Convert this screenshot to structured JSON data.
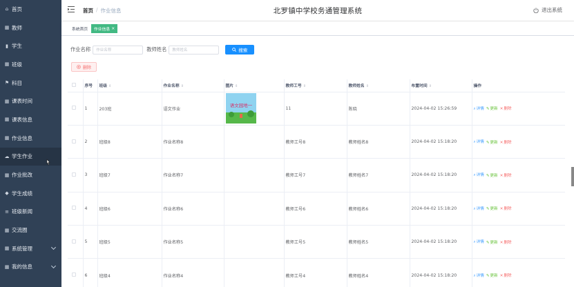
{
  "app": {
    "title": "北罗镇中学校务通管理系统",
    "logout_label": "退出系统",
    "accent": "#42b983",
    "primary": "#1890ff",
    "danger": "#f56c6c"
  },
  "sidebar": {
    "items": [
      {
        "label": "首页",
        "icon": "home-icon"
      },
      {
        "label": "教师",
        "icon": "grid-icon"
      },
      {
        "label": "学生",
        "icon": "bar-chart-icon"
      },
      {
        "label": "班级",
        "icon": "grid-icon"
      },
      {
        "label": "科目",
        "icon": "flag-icon"
      },
      {
        "label": "课表时间",
        "icon": "grid-icon"
      },
      {
        "label": "课表信息",
        "icon": "grid-icon"
      },
      {
        "label": "作业信息",
        "icon": "grid-icon"
      },
      {
        "label": "学生作业",
        "icon": "cloud-icon"
      },
      {
        "label": "作业批改",
        "icon": "grid-icon"
      },
      {
        "label": "学生成绩",
        "icon": "pin-icon"
      },
      {
        "label": "班级新闻",
        "icon": "list-icon"
      },
      {
        "label": "交流圈",
        "icon": "grid-icon"
      },
      {
        "label": "系统管理",
        "icon": "grid-icon"
      },
      {
        "label": "我的信息",
        "icon": "grid-icon"
      }
    ]
  },
  "breadcrumb": {
    "home": "首页",
    "separator": "/",
    "current": "作业信息"
  },
  "tags": {
    "home": "系统首页",
    "active": "作业信息",
    "close": "×"
  },
  "search": {
    "label1": "作业名称",
    "placeholder1": "作业名称",
    "label2": "教师姓名",
    "placeholder2": "教师姓名",
    "button": "搜索",
    "delete_button": "删除"
  },
  "table": {
    "headers": [
      "序号",
      "班级",
      "作业名称",
      "图片",
      "教师工号",
      "教师姓名",
      "布置时间",
      "操作"
    ],
    "rows": [
      {
        "no": "1",
        "class": "203班",
        "name": "语文作业",
        "has_image": true,
        "teacher_id": "11",
        "teacher_name": "陈晓",
        "time": "2024-04-02 15:26:59"
      },
      {
        "no": "2",
        "class": "班级8",
        "name": "作业名称8",
        "has_image": false,
        "teacher_id": "教师工号8",
        "teacher_name": "教师姓名8",
        "time": "2024-04-02 15:18:20"
      },
      {
        "no": "3",
        "class": "班级7",
        "name": "作业名称7",
        "has_image": false,
        "teacher_id": "教师工号7",
        "teacher_name": "教师姓名7",
        "time": "2024-04-02 15:18:20"
      },
      {
        "no": "4",
        "class": "班级6",
        "name": "作业名称6",
        "has_image": false,
        "teacher_id": "教师工号6",
        "teacher_name": "教师姓名6",
        "time": "2024-04-02 15:18:20"
      },
      {
        "no": "5",
        "class": "班级5",
        "name": "作业名称5",
        "has_image": false,
        "teacher_id": "教师工号5",
        "teacher_name": "教师姓名5",
        "time": "2024-04-02 15:18:20"
      },
      {
        "no": "6",
        "class": "班级4",
        "name": "作业名称4",
        "has_image": false,
        "teacher_id": "教师工号4",
        "teacher_name": "教师姓名4",
        "time": "2024-04-02 15:18:20"
      }
    ],
    "ops": {
      "detail": "详情",
      "edit": "更新",
      "delete": "删除"
    }
  },
  "thumbnail": {
    "text": "语文园地一"
  }
}
